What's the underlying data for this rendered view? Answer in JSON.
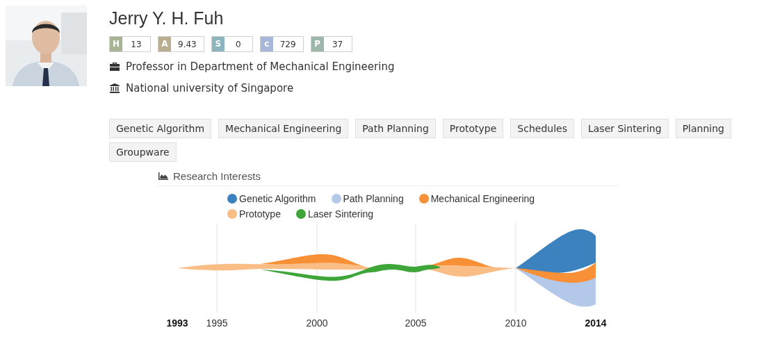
{
  "profile": {
    "name": "Jerry Y. H. Fuh",
    "badges": [
      {
        "letter": "H",
        "value": "13",
        "color": "#a7b596"
      },
      {
        "letter": "A",
        "value": "9.43",
        "color": "#b9ae90"
      },
      {
        "letter": "S",
        "value": "0",
        "color": "#8db5bd"
      },
      {
        "letter": "c",
        "value": "729",
        "color": "#a8b6da"
      },
      {
        "letter": "P",
        "value": "37",
        "color": "#9db7ab"
      }
    ],
    "position": "Professor in Department of Mechanical Engineering",
    "affiliation": "National university of Singapore"
  },
  "tags": [
    "Genetic Algorithm",
    "Mechanical Engineering",
    "Path Planning",
    "Prototype",
    "Schedules",
    "Laser Sintering",
    "Planning",
    "Groupware"
  ],
  "research_interests": {
    "title": "Research Interests",
    "legend": [
      {
        "name": "Genetic Algorithm",
        "color": "#3b82bf"
      },
      {
        "name": "Path Planning",
        "color": "#b4c8ea"
      },
      {
        "name": "Mechanical Engineering",
        "color": "#f79036"
      },
      {
        "name": "Prototype",
        "color": "#fbbd86"
      },
      {
        "name": "Laser Sintering",
        "color": "#3ea639"
      }
    ],
    "axis_labels": [
      {
        "label": "1993",
        "bold": true
      },
      {
        "label": "1995",
        "bold": false
      },
      {
        "label": "2000",
        "bold": false
      },
      {
        "label": "2005",
        "bold": false
      },
      {
        "label": "2010",
        "bold": false
      },
      {
        "label": "2014",
        "bold": true
      }
    ]
  }
}
